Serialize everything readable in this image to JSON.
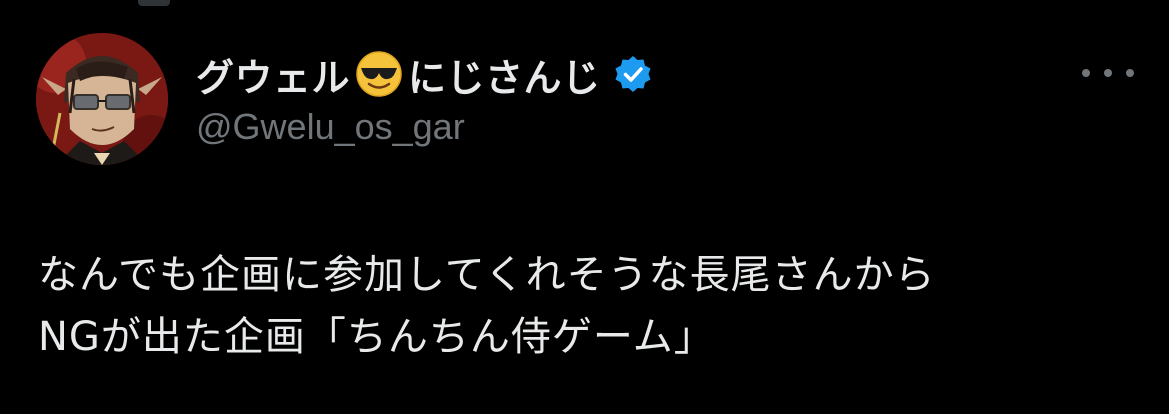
{
  "author": {
    "display_name_part1": "グウェル",
    "display_name_emoji": "smiling-face-with-sunglasses",
    "display_name_part2": "にじさんじ",
    "handle": "@Gwelu_os_gar",
    "verified": true,
    "avatar_icon": "avatar-illustration"
  },
  "tweet": {
    "lines": [
      "なんでも企画に参加してくれそうな長尾さんから",
      "NGが出た企画「ちんちん侍ゲーム」"
    ]
  },
  "menu": {
    "icon": "more-icon"
  },
  "colors": {
    "background": "#000000",
    "text_primary": "#e7e9ea",
    "text_secondary": "#71767b",
    "verified_badge": "#1d9bf0"
  }
}
